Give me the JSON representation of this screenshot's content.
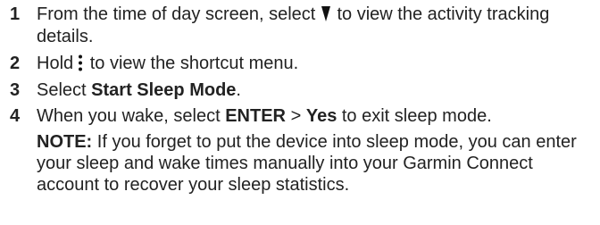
{
  "steps": [
    {
      "num": "1",
      "before_icon": "From the time of day screen, select",
      "icon": "down-triangle-icon",
      "after_icon": "to view the activity tracking details."
    },
    {
      "num": "2",
      "before_icon": "Hold",
      "icon": "vertical-dots-menu-icon",
      "after_icon": "to view the shortcut menu."
    },
    {
      "num": "3",
      "prefix": "Select",
      "bold": "Start Sleep Mode",
      "suffix": "."
    },
    {
      "num": "4",
      "prefix": "When you wake, select",
      "bold1": "ENTER",
      "sep": ">",
      "bold2": "Yes",
      "suffix": "to exit sleep mode."
    }
  ],
  "note": {
    "label": "NOTE:",
    "text": "If you forget to put the device into sleep mode, you can enter your sleep and wake times manually into your Garmin Connect account to recover your sleep statistics."
  }
}
